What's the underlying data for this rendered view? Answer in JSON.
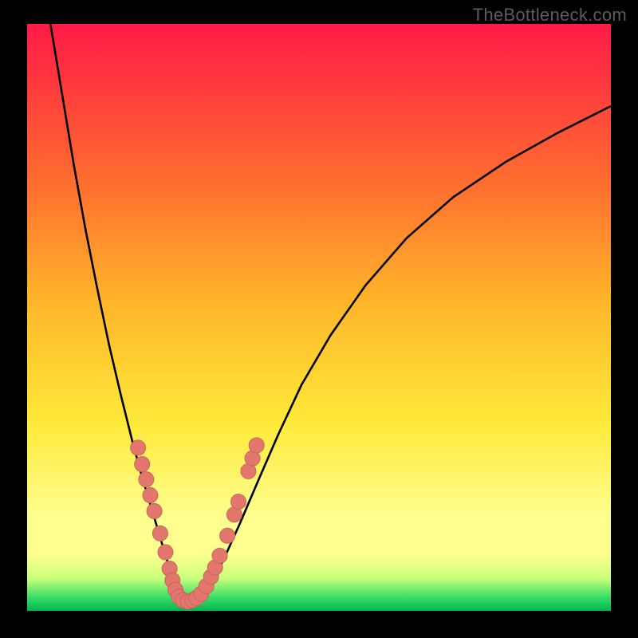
{
  "watermark": "TheBottleneck.com",
  "colors": {
    "frame": "#000000",
    "curve": "#000000",
    "dot_fill": "#e3776e",
    "dot_stroke": "#c9645a",
    "grad_top": "#ff1a47",
    "grad_mid1": "#ff6a30",
    "grad_mid2": "#ffb72a",
    "grad_mid3": "#ffe93a",
    "grad_band": "#fdff8f",
    "grad_green1": "#c8ff7a",
    "grad_green2": "#3fe06a",
    "grad_bottom": "#00b64d"
  },
  "chart_data": {
    "type": "line",
    "title": "",
    "xlabel": "",
    "ylabel": "",
    "xlim": [
      0,
      100
    ],
    "ylim": [
      0,
      100
    ],
    "grid": false,
    "legend": false,
    "series": [
      {
        "name": "left-branch",
        "x": [
          4,
          6,
          8,
          10,
          12,
          14,
          16,
          18,
          19.5,
          21,
          22.5,
          24,
          25,
          25.8
        ],
        "y": [
          100,
          88,
          76,
          65,
          55,
          45.5,
          37,
          29,
          23.5,
          18.5,
          13.5,
          8.5,
          4.5,
          2.2
        ]
      },
      {
        "name": "valley",
        "x": [
          25.8,
          26.5,
          27.3,
          28.2,
          29.2,
          30.3
        ],
        "y": [
          2.2,
          1.5,
          1.3,
          1.4,
          1.8,
          2.6
        ]
      },
      {
        "name": "right-branch",
        "x": [
          30.3,
          32,
          34,
          36.5,
          39.5,
          43,
          47,
          52,
          58,
          65,
          73,
          82,
          91,
          100
        ],
        "y": [
          2.6,
          5.2,
          9.5,
          15,
          22,
          30,
          38.5,
          47,
          55.5,
          63.5,
          70.5,
          76.5,
          81.5,
          86
        ]
      }
    ],
    "highlight_points": {
      "name": "scatter-overlay",
      "points": [
        [
          19.0,
          27.8
        ],
        [
          19.7,
          25.0
        ],
        [
          20.4,
          22.4
        ],
        [
          21.1,
          19.7
        ],
        [
          21.8,
          17.0
        ],
        [
          22.8,
          13.2
        ],
        [
          23.7,
          10.0
        ],
        [
          24.4,
          7.2
        ],
        [
          24.9,
          5.2
        ],
        [
          25.4,
          3.6
        ],
        [
          26.0,
          2.4
        ],
        [
          26.7,
          1.8
        ],
        [
          27.5,
          1.6
        ],
        [
          28.3,
          1.8
        ],
        [
          29.0,
          2.2
        ],
        [
          29.8,
          2.9
        ],
        [
          30.7,
          4.2
        ],
        [
          31.5,
          5.8
        ],
        [
          32.2,
          7.4
        ],
        [
          33.0,
          9.4
        ],
        [
          34.3,
          12.8
        ],
        [
          35.5,
          16.4
        ],
        [
          36.2,
          18.6
        ],
        [
          37.9,
          23.8
        ],
        [
          38.6,
          26.0
        ],
        [
          39.3,
          28.2
        ]
      ]
    }
  }
}
